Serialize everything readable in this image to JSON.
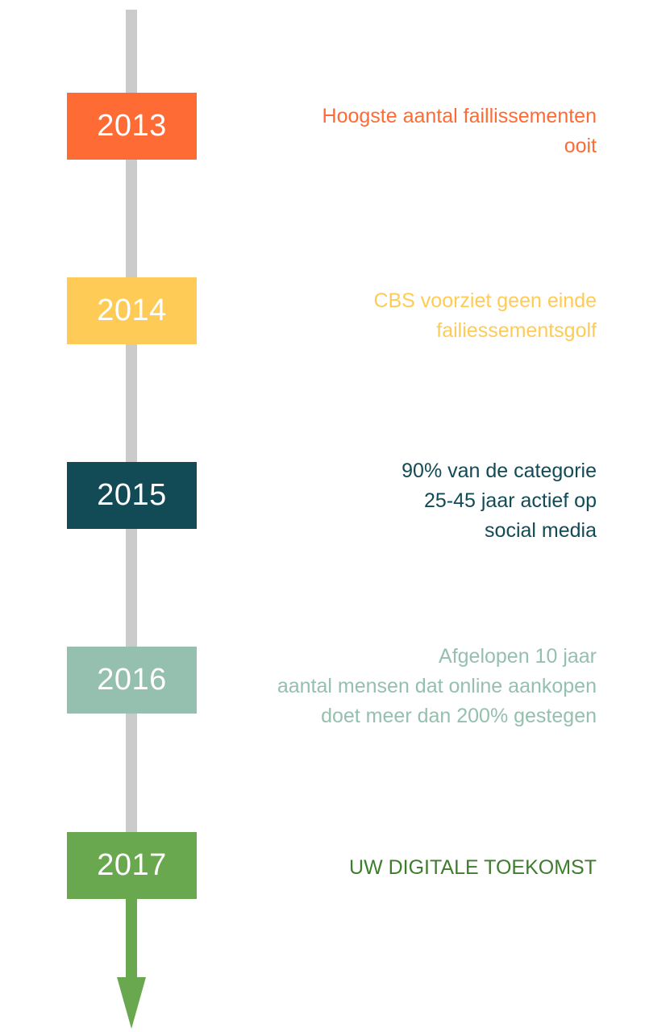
{
  "colors": {
    "spine": "#cbcbcb",
    "arrow": "#6aa84f"
  },
  "events": [
    {
      "year": "2013",
      "color": "#ff6b35",
      "lines": [
        "Hoogste aantal faillissementen",
        "ooit"
      ]
    },
    {
      "year": "2014",
      "color": "#fecb57",
      "lines": [
        "CBS voorziet geen einde",
        "failiessementsgolf"
      ]
    },
    {
      "year": "2015",
      "color": "#124a56",
      "lines": [
        "90% van de categorie",
        "25-45 jaar actief op",
        "social media"
      ]
    },
    {
      "year": "2016",
      "color": "#95bfae",
      "lines": [
        "Afgelopen 10 jaar",
        "aantal mensen dat online aankopen",
        "doet meer dan 200% gestegen"
      ]
    },
    {
      "year": "2017",
      "color": "#6aa84f",
      "text_color": "#3e7d2e",
      "lines": [
        "UW DIGITALE TOEKOMST"
      ]
    }
  ]
}
